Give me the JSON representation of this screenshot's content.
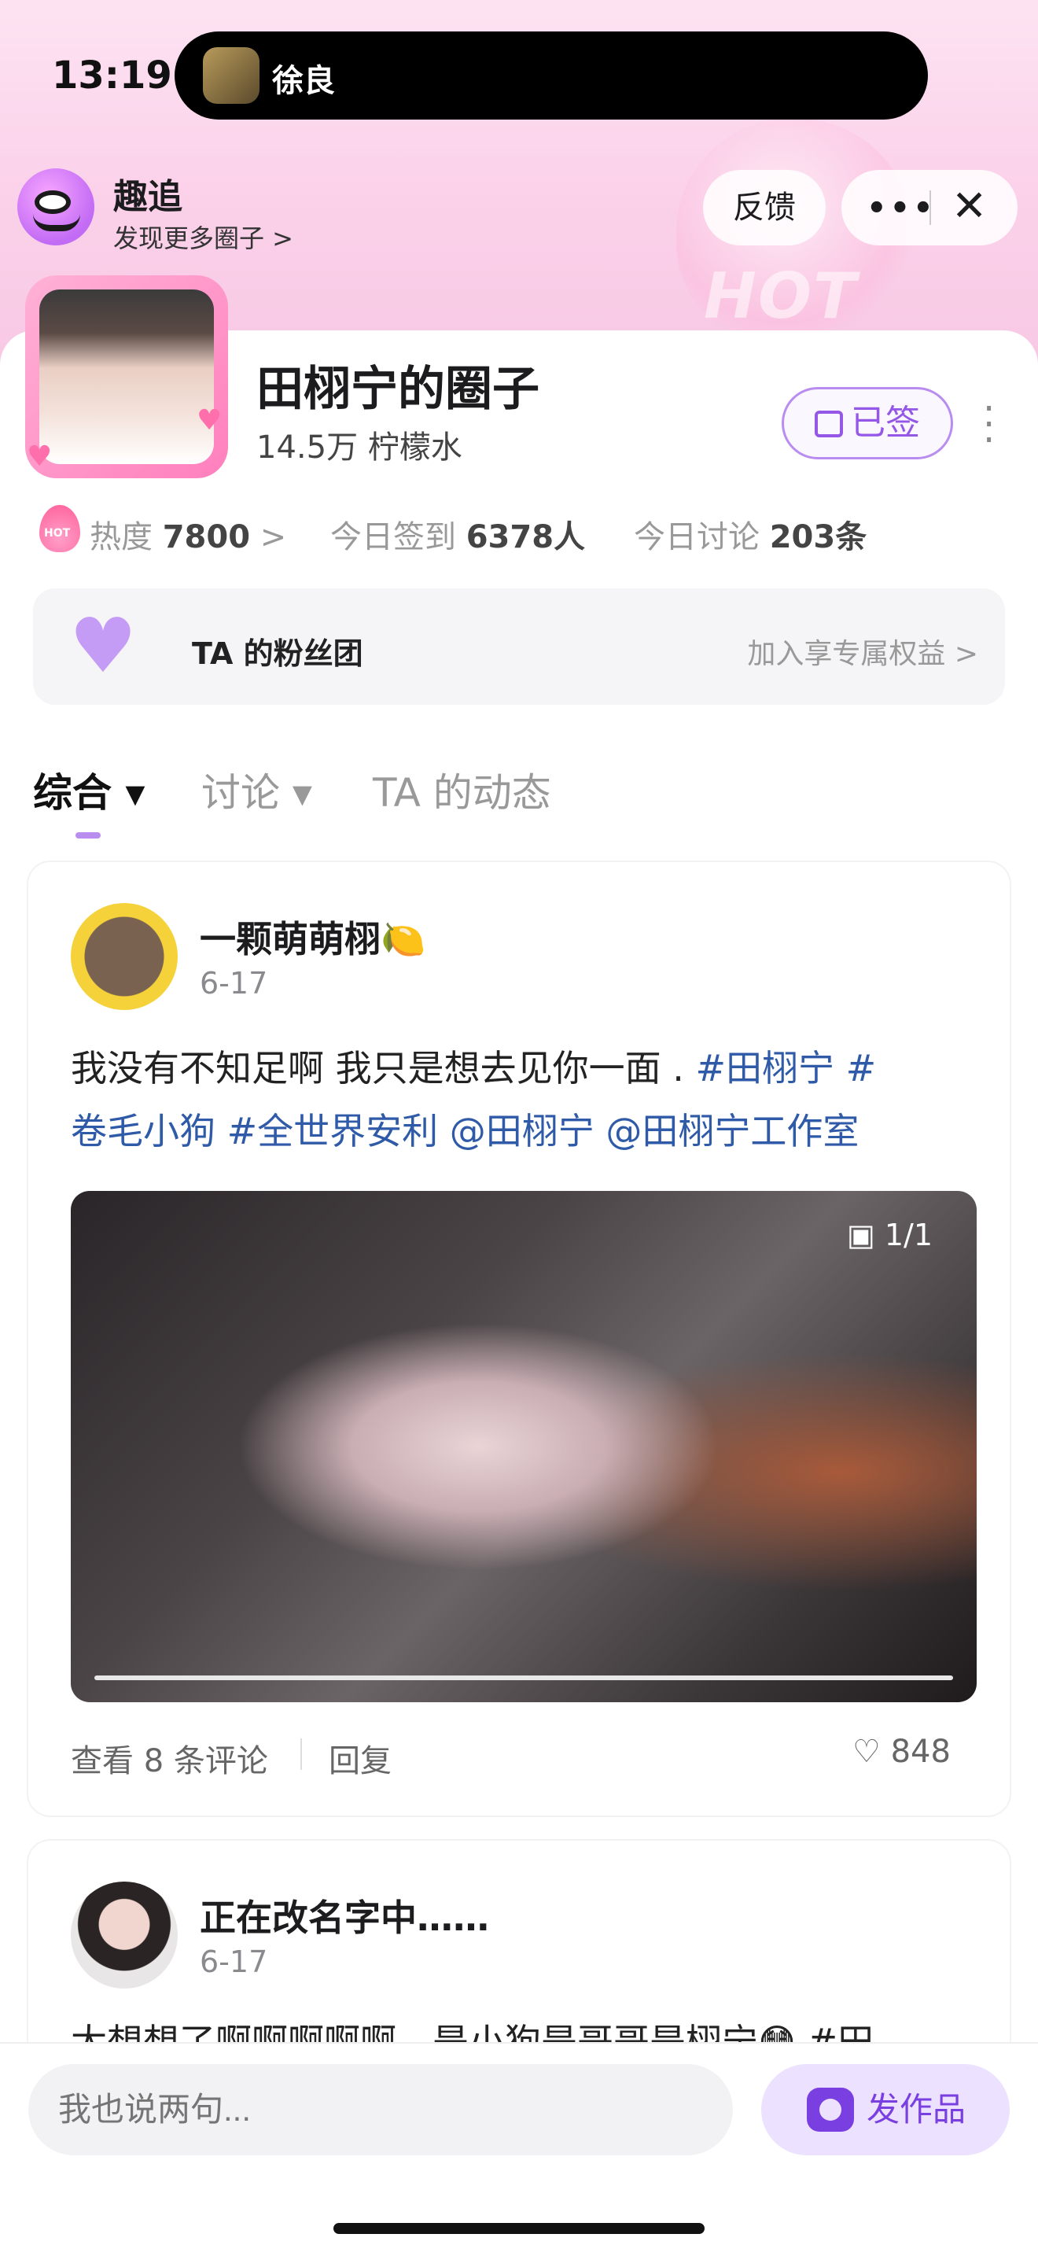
{
  "status_bar": {
    "time": "13:19",
    "island_contact": "徐良"
  },
  "header": {
    "app_name": "趣追",
    "discover_link": "发现更多圈子 >",
    "feedback_label": "反馈",
    "more_label": "•••",
    "close_label": "✕",
    "hot_badge": "HOT"
  },
  "circle": {
    "title": "田栩宁的圈子",
    "subtitle": "14.5万 柠檬水",
    "signed_label": "已签",
    "menu_label": "⋮",
    "stats": {
      "heat_icon_label": "HOT",
      "heat_label": "热度",
      "heat_value": "7800",
      "heat_arrow": ">",
      "checkin_label": "今日签到",
      "checkin_value": "6378人",
      "discuss_label": "今日讨论",
      "discuss_value": "203条"
    },
    "fans": {
      "title": "TA 的粉丝团",
      "action": "加入享专属权益 >"
    }
  },
  "tabs": [
    {
      "label": "综合 ▾"
    },
    {
      "label": "讨论 ▾"
    },
    {
      "label": "TA 的动态"
    }
  ],
  "posts": [
    {
      "author": "一颗萌萌栩🍋",
      "date": "6-17",
      "text_plain": "我没有不知足啊 我只是想去见你一面 . ",
      "tags_line1": "#田栩宁 #",
      "tags_line2": "卷毛小狗 #全世界安利 @田栩宁 @田栩宁工作室",
      "image_count": "1/1",
      "view_comments": "查看 8 条评论",
      "reply": "回复",
      "likes": "848"
    },
    {
      "author": "正在改名字中……",
      "date": "6-17",
      "text_preview": "太想想了啊啊啊啊啊，是小狗是哥哥是栩宁😳 #田"
    }
  ],
  "bottom_bar": {
    "input_placeholder": "我也说两句...",
    "publish_label": "发作品"
  },
  "colors": {
    "accent": "#9457e6",
    "tag_link": "#2f5aa8",
    "hero_pink": "#fbd2ea"
  }
}
